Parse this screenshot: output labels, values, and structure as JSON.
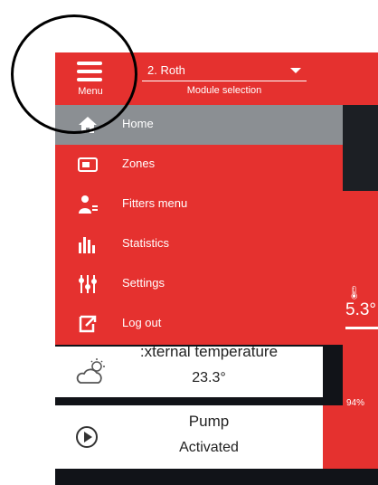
{
  "header": {
    "menu_label": "Menu",
    "module_value": "2. Roth",
    "module_hint": "Module selection"
  },
  "drawer": {
    "items": [
      {
        "label": "Home",
        "icon": "home-icon",
        "active": true
      },
      {
        "label": "Zones",
        "icon": "zones-icon"
      },
      {
        "label": "Fitters menu",
        "icon": "fitter-icon"
      },
      {
        "label": "Statistics",
        "icon": "statistics-icon"
      },
      {
        "label": "Settings",
        "icon": "settings-icon"
      },
      {
        "label": "Log out",
        "icon": "logout-icon"
      }
    ]
  },
  "background": {
    "side_temp": "5.3°",
    "battery": "94%"
  },
  "cards": {
    "external": {
      "title": ":xternal temperature",
      "value": "23.3°",
      "icon": "weather-icon"
    },
    "pump": {
      "title": "Pump",
      "value": "Activated",
      "icon": "play-icon"
    }
  },
  "colors": {
    "accent": "#e5312f",
    "active_item": "#8b8f93",
    "dark": "#111318"
  }
}
